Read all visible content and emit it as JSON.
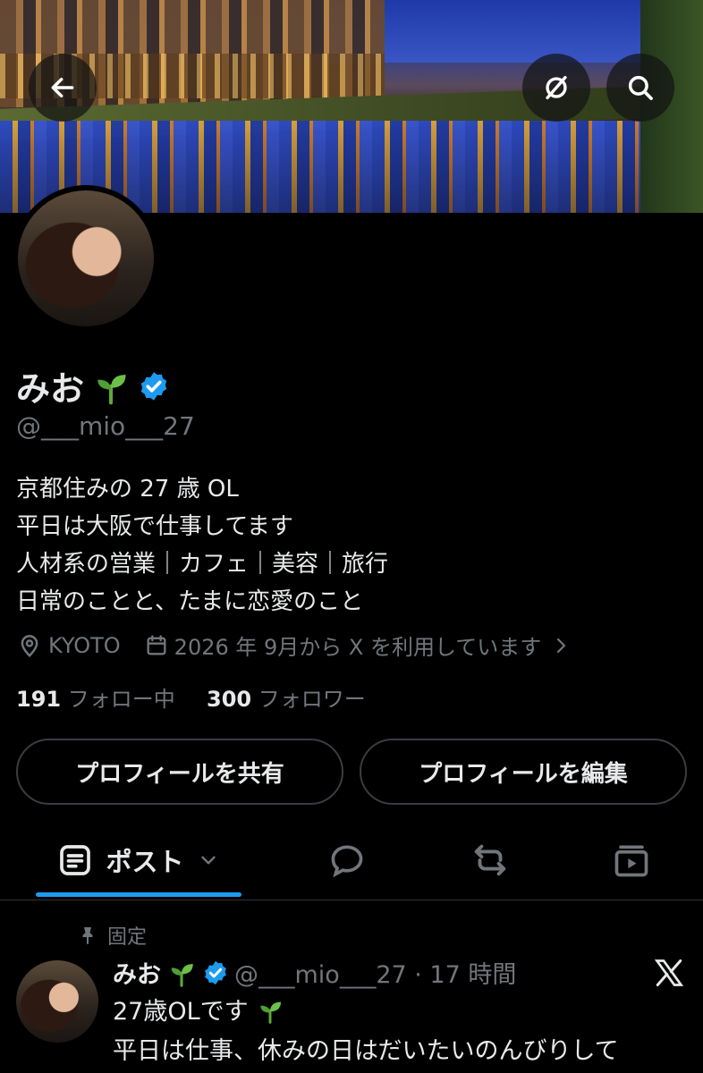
{
  "profile": {
    "name": "みお",
    "handle": "@___mio___27",
    "bio": [
      "京都住みの 27 歳 OL",
      "平日は大阪で仕事してます",
      "人材系の営業｜カフェ｜美容｜旅行",
      "日常のことと、たまに恋愛のこと"
    ],
    "location": "KYOTO",
    "joined": "2026 年 9月から X を利用しています",
    "following_count": "191",
    "following_label": "フォロー中",
    "followers_count": "300",
    "followers_label": "フォロワー"
  },
  "buttons": {
    "share": "プロフィールを共有",
    "edit": "プロフィールを編集"
  },
  "tabs": {
    "posts": "ポスト"
  },
  "post": {
    "pinned_label": "固定",
    "name": "みお",
    "handle_time": "@___mio___27 · 17 時間",
    "lines": [
      "27歳OLです",
      "平日は仕事、休みの日はだいたいのんびりして"
    ]
  },
  "colors": {
    "verified": "#1d9bf0",
    "background": "#000000",
    "muted": "#71767b"
  },
  "icons": [
    "back-arrow-icon",
    "hide-icon",
    "search-icon",
    "verified-badge-icon",
    "location-icon",
    "calendar-icon",
    "chevron-right-icon",
    "posts-icon",
    "chevron-down-icon",
    "reply-icon",
    "repost-icon",
    "media-icon",
    "pin-icon",
    "x-logo-icon",
    "sprout-emoji-icon"
  ]
}
